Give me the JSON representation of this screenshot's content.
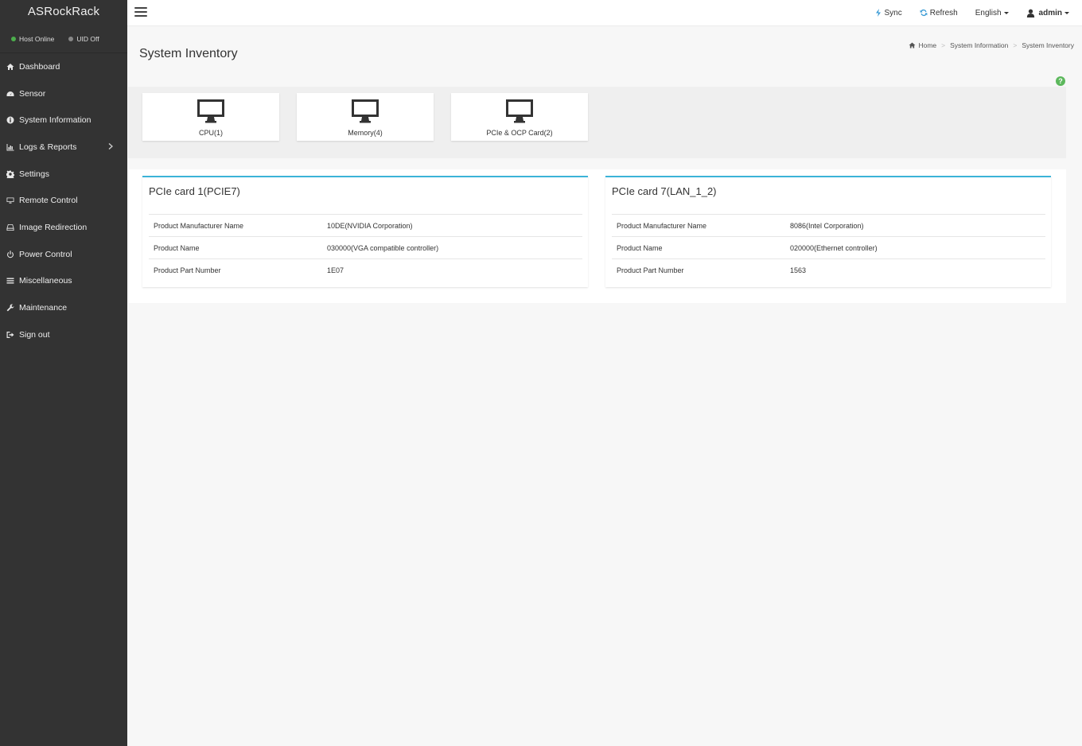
{
  "app": {
    "brand": "ASRockRack"
  },
  "status": [
    {
      "label": "Host Online",
      "color": "#4cae4c"
    },
    {
      "label": "UID Off",
      "color": "#888888"
    }
  ],
  "nav": [
    {
      "label": "Dashboard",
      "icon": "home-icon"
    },
    {
      "label": "Sensor",
      "icon": "gauge-icon"
    },
    {
      "label": "System Information",
      "icon": "info-icon"
    },
    {
      "label": "Logs & Reports",
      "icon": "bar-chart-icon",
      "has_submenu": true
    },
    {
      "label": "Settings",
      "icon": "gear-icon"
    },
    {
      "label": "Remote Control",
      "icon": "monitor-icon"
    },
    {
      "label": "Image Redirection",
      "icon": "disk-icon"
    },
    {
      "label": "Power Control",
      "icon": "power-icon"
    },
    {
      "label": "Miscellaneous",
      "icon": "list-icon"
    },
    {
      "label": "Maintenance",
      "icon": "wrench-icon"
    },
    {
      "label": "Sign out",
      "icon": "sign-out-icon"
    }
  ],
  "topbar": {
    "sync": "Sync",
    "refresh": "Refresh",
    "language": "English",
    "user": "admin",
    "accent": "#3a9bd5"
  },
  "page": {
    "title": "System Inventory"
  },
  "breadcrumb": [
    "Home",
    "System Information",
    "System Inventory"
  ],
  "tiles": [
    {
      "label": "CPU(1)"
    },
    {
      "label": "Memory(4)"
    },
    {
      "label": "PCIe & OCP Card(2)"
    }
  ],
  "cards": [
    {
      "title": "PCIe card 1(PCIE7)",
      "rows": [
        {
          "key": "Product Manufacturer Name",
          "value": "10DE(NVIDIA Corporation)"
        },
        {
          "key": "Product Name",
          "value": "030000(VGA compatible controller)"
        },
        {
          "key": "Product Part Number",
          "value": "1E07"
        }
      ]
    },
    {
      "title": "PCIe card 7(LAN_1_2)",
      "rows": [
        {
          "key": "Product Manufacturer Name",
          "value": "8086(Intel Corporation)"
        },
        {
          "key": "Product Name",
          "value": "020000(Ethernet controller)"
        },
        {
          "key": "Product Part Number",
          "value": "1563"
        }
      ]
    }
  ]
}
